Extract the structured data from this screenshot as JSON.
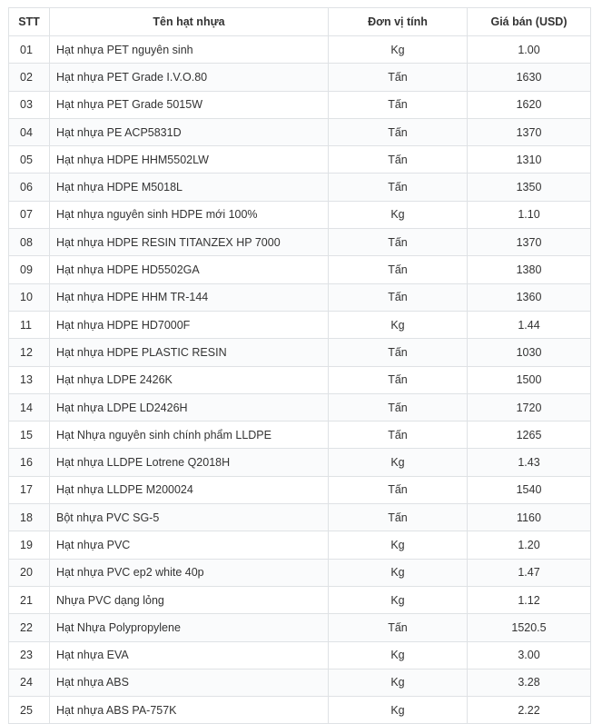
{
  "table": {
    "headers": {
      "stt": "STT",
      "name": "Tên hạt nhựa",
      "unit": "Đơn vị tính",
      "price": "Giá bán (USD)"
    },
    "rows": [
      {
        "stt": "01",
        "name": "Hạt nhựa PET nguyên sinh",
        "unit": "Kg",
        "price": "1.00"
      },
      {
        "stt": "02",
        "name": "Hạt nhựa PET Grade I.V.O.80",
        "unit": "Tấn",
        "price": "1630"
      },
      {
        "stt": "03",
        "name": "Hạt nhựa PET Grade 5015W",
        "unit": "Tấn",
        "price": "1620"
      },
      {
        "stt": "04",
        "name": "Hạt nhựa PE ACP5831D",
        "unit": "Tấn",
        "price": "1370"
      },
      {
        "stt": "05",
        "name": "Hạt nhựa HDPE HHM5502LW",
        "unit": "Tấn",
        "price": "1310"
      },
      {
        "stt": "06",
        "name": "Hạt nhựa HDPE M5018L",
        "unit": "Tấn",
        "price": "1350"
      },
      {
        "stt": "07",
        "name": "Hạt nhựa nguyên sinh HDPE mới 100%",
        "unit": "Kg",
        "price": "1.10"
      },
      {
        "stt": "08",
        "name": "Hạt nhựa HDPE RESIN TITANZEX HP 7000",
        "unit": "Tấn",
        "price": "1370"
      },
      {
        "stt": "09",
        "name": "Hạt nhựa HDPE HD5502GA",
        "unit": "Tấn",
        "price": "1380"
      },
      {
        "stt": "10",
        "name": "Hạt nhựa HDPE HHM TR-144",
        "unit": "Tấn",
        "price": "1360"
      },
      {
        "stt": "11",
        "name": "Hạt nhựa HDPE HD7000F",
        "unit": "Kg",
        "price": "1.44"
      },
      {
        "stt": "12",
        "name": "Hạt nhựa HDPE PLASTIC RESIN",
        "unit": "Tấn",
        "price": "1030"
      },
      {
        "stt": "13",
        "name": "Hạt nhựa LDPE 2426K",
        "unit": "Tấn",
        "price": "1500"
      },
      {
        "stt": "14",
        "name": "Hạt nhựa LDPE LD2426H",
        "unit": "Tấn",
        "price": "1720"
      },
      {
        "stt": "15",
        "name": "Hạt Nhựa nguyên sinh chính phẩm LLDPE",
        "unit": "Tấn",
        "price": "1265"
      },
      {
        "stt": "16",
        "name": "Hạt nhựa LLDPE Lotrene Q2018H",
        "unit": "Kg",
        "price": "1.43"
      },
      {
        "stt": "17",
        "name": "Hạt nhựa LLDPE M200024",
        "unit": "Tấn",
        "price": "1540"
      },
      {
        "stt": "18",
        "name": "Bột nhựa PVC SG-5",
        "unit": "Tấn",
        "price": "1160"
      },
      {
        "stt": "19",
        "name": "Hạt nhựa PVC",
        "unit": "Kg",
        "price": "1.20"
      },
      {
        "stt": "20",
        "name": "Hạt nhựa PVC ep2 white 40p",
        "unit": "Kg",
        "price": "1.47"
      },
      {
        "stt": "21",
        "name": "Nhựa PVC dạng lỏng",
        "unit": "Kg",
        "price": "1.12"
      },
      {
        "stt": "22",
        "name": "Hạt Nhựa Polypropylene",
        "unit": "Tấn",
        "price": "1520.5"
      },
      {
        "stt": "23",
        "name": "Hạt nhựa EVA",
        "unit": "Kg",
        "price": "3.00"
      },
      {
        "stt": "24",
        "name": "Hạt nhựa ABS",
        "unit": "Kg",
        "price": "3.28"
      },
      {
        "stt": "25",
        "name": "Hạt nhựa ABS PA-757K",
        "unit": "Kg",
        "price": "2.22"
      }
    ]
  },
  "colors": {
    "border": "#dfe2e5",
    "text": "#333333",
    "stripe": "#fafbfc"
  }
}
